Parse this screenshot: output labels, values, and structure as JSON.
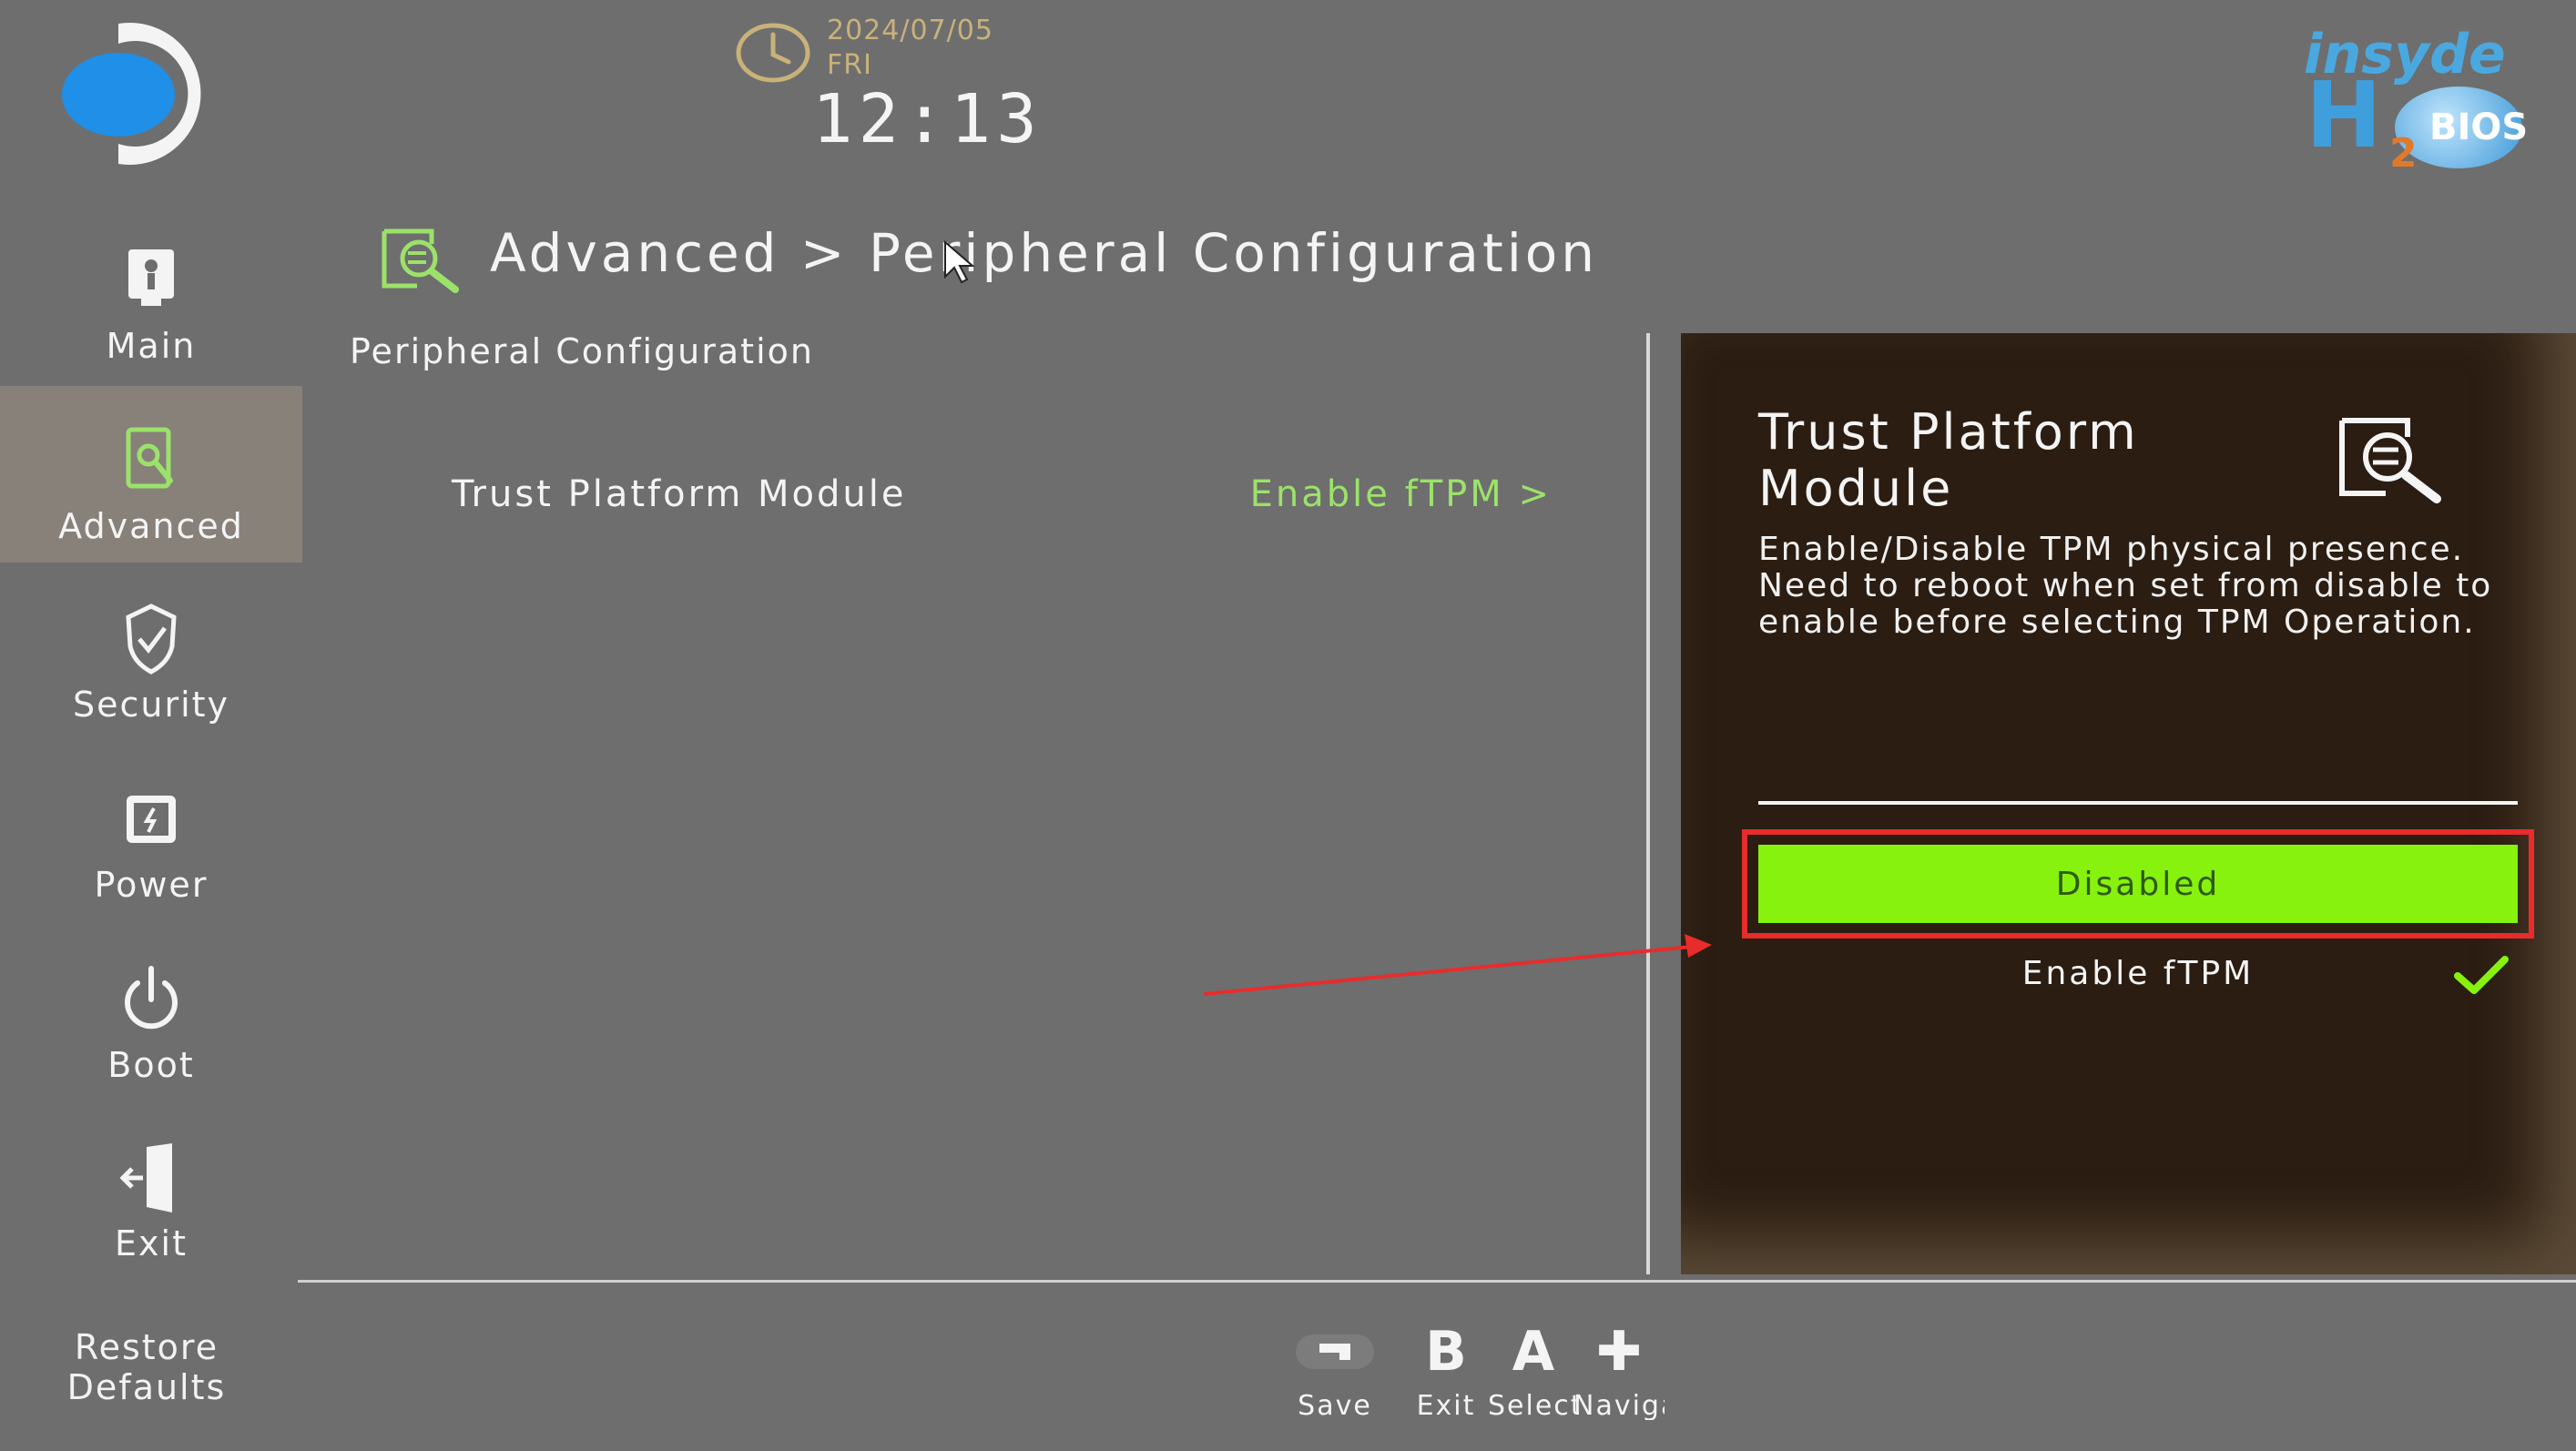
{
  "clock": {
    "date": "2024/07/05",
    "day": "FRI",
    "time": "12:13"
  },
  "brand": {
    "name": "insyde",
    "badge": "BIOS",
    "h": "H",
    "two": "2"
  },
  "sidebar": {
    "items": [
      {
        "label": "Main",
        "icon": "main-icon",
        "active": false
      },
      {
        "label": "Advanced",
        "icon": "advanced-icon",
        "active": true
      },
      {
        "label": "Security",
        "icon": "shield-icon",
        "active": false
      },
      {
        "label": "Power",
        "icon": "power-icon",
        "active": false
      },
      {
        "label": "Boot",
        "icon": "boot-icon",
        "active": false
      },
      {
        "label": "Exit",
        "icon": "exit-icon",
        "active": false
      }
    ],
    "restore_line1": "Restore",
    "restore_line2": "Defaults"
  },
  "breadcrumb": "Advanced > Peripheral Configuration",
  "section_title": "Peripheral Configuration",
  "options": [
    {
      "label": "Trust Platform Module",
      "value": "Enable fTPM >"
    }
  ],
  "panel": {
    "title": "Trust Platform Module",
    "description": "Enable/Disable TPM physical presence. Need to reboot when set from disable to enable before selecting TPM Operation.",
    "choices": [
      {
        "label": "Disabled",
        "highlighted": true
      },
      {
        "label": "Enable fTPM",
        "checked": true
      }
    ]
  },
  "footer_keys": [
    {
      "glyph": "",
      "icon": "save-key-icon",
      "label": "Save and"
    },
    {
      "glyph": "B",
      "label": "Exit"
    },
    {
      "glyph": "A",
      "label": "Select"
    },
    {
      "glyph": "✚",
      "label": "Navigation"
    }
  ],
  "colors": {
    "background": "#6e6e6e",
    "panel": "#2b1d12",
    "accent_green": "#86f20e",
    "value_green": "#9be26a",
    "annotation_red": "#e82c2c"
  }
}
